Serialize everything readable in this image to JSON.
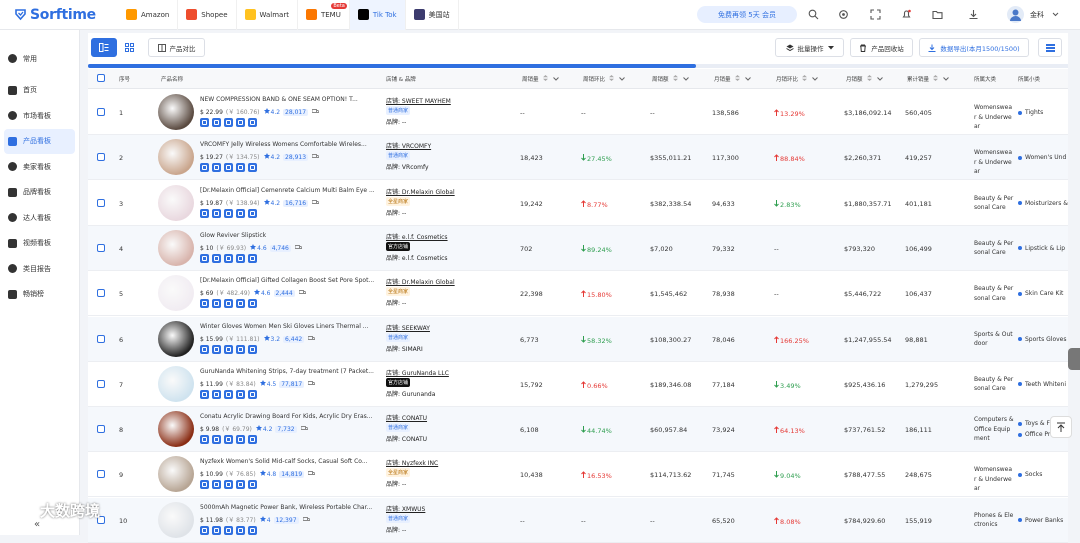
{
  "brand": {
    "name": "Sorftime"
  },
  "platforms": [
    {
      "label": "Amazon",
      "color": "#ff9900"
    },
    {
      "label": "Shopee",
      "color": "#ee4d2d"
    },
    {
      "label": "Walmart",
      "color": "#ffc220"
    },
    {
      "label": "TEMU",
      "color": "#fb7701",
      "badge": "Beta"
    },
    {
      "label": "Tik Tok",
      "color": "#000000"
    },
    {
      "label": "美国站",
      "color": "#3c3b6e"
    }
  ],
  "trial": "免费再领 5天 会员",
  "user": {
    "name": "金科"
  },
  "sidebar": [
    {
      "label": "常用"
    },
    {
      "label": "首页"
    },
    {
      "label": "市场看板"
    },
    {
      "label": "产品看板"
    },
    {
      "label": "卖家看板"
    },
    {
      "label": "品牌看板"
    },
    {
      "label": "达人看板"
    },
    {
      "label": "视频看板"
    },
    {
      "label": "类目报告"
    },
    {
      "label": "畅销榜"
    }
  ],
  "toolbar": {
    "compare": "产品对比",
    "batch": "批量操作",
    "recycle": "产品回收站",
    "export": "数据导出(本月1500/1500)"
  },
  "progress": 0.62,
  "columns": [
    "序号",
    "产品名称",
    "店铺 & 品牌",
    "周销量",
    "周销环比",
    "周销额",
    "月销量",
    "月销环比",
    "月销额",
    "累计销量",
    "所属大类",
    "所属小类"
  ],
  "rows": [
    {
      "idx": "1",
      "name": "NEW COMPRESSION BAND & ONE SEAM OPTION! T...",
      "price": "$ 22.99",
      "old": "(￥ 160.76)",
      "rating": "4.2",
      "reviews": "28,017",
      "shop": "店铺: SWEET MAYHEM",
      "tag": "普通商家",
      "tagc": "blue",
      "brand": "品牌: --",
      "wk": "--",
      "wkc": "--",
      "wkdir": "",
      "wkamt": "--",
      "mo": "138,586",
      "moc": "13.29%",
      "modir": "up",
      "moamt": "$3,186,092.14",
      "total": "560,405",
      "cat": "Womenswear & Underwear",
      "sub": [
        "Tights"
      ],
      "thumb": "#5a4a40"
    },
    {
      "idx": "2",
      "name": "VRCOMFY Jelly Wireless Womens Comfortable Wireles...",
      "price": "$ 19.27",
      "old": "(￥ 134.75)",
      "rating": "4.2",
      "reviews": "28,913",
      "shop": "店铺: VRCOMFY",
      "tag": "普通商家",
      "tagc": "blue",
      "brand": "品牌: VRcomfy",
      "wk": "18,423",
      "wkc": "27.45%",
      "wkdir": "down",
      "wkamt": "$355,011.21",
      "mo": "117,300",
      "moc": "88.84%",
      "modir": "up",
      "moamt": "$2,260,371",
      "total": "419,257",
      "cat": "Womenswear & Underwear",
      "sub": [
        "Women's Und"
      ],
      "thumb": "#c9a58c"
    },
    {
      "idx": "3",
      "name": "[Dr.Melaxin Official] Cemenrete Calcium Multi Balm Eye ...",
      "price": "$ 19.87",
      "old": "(￥ 138.94)",
      "rating": "4.2",
      "reviews": "16,716",
      "shop": "店铺: Dr.Melaxin Global",
      "tag": "全星商家",
      "tagc": "gold",
      "brand": "品牌: --",
      "wk": "19,242",
      "wkc": "8.77%",
      "wkdir": "up",
      "wkamt": "$382,338.54",
      "mo": "94,633",
      "moc": "2.83%",
      "modir": "down",
      "moamt": "$1,880,357.71",
      "total": "401,181",
      "cat": "Beauty & Personal Care",
      "sub": [
        "Moisturizers &"
      ],
      "thumb": "#e9d8df"
    },
    {
      "idx": "4",
      "name": "Glow Reviver Slipstick",
      "price": "$ 10",
      "old": "(￥ 69.93)",
      "rating": "4.6",
      "reviews": "4,746",
      "shop": "店铺: e.l.f. Cosmetics",
      "tag": "官方店铺",
      "tagc": "black",
      "brand": "品牌: e.l.f. Cosmetics",
      "wk": "702",
      "wkc": "89.24%",
      "wkdir": "down",
      "wkamt": "$7,020",
      "mo": "79,332",
      "moc": "--",
      "modir": "",
      "moamt": "$793,320",
      "total": "106,499",
      "cat": "Beauty & Personal Care",
      "sub": [
        "Lipstick & Lip"
      ],
      "thumb": "#d8b4ac"
    },
    {
      "idx": "5",
      "name": "[Dr.Melaxin Official] Gifted Collagen Boost Set Pore Spot...",
      "price": "$ 69",
      "old": "(￥ 482.49)",
      "rating": "4.6",
      "reviews": "2,444",
      "shop": "店铺: Dr.Melaxin Global",
      "tag": "全星商家",
      "tagc": "gold",
      "brand": "品牌: --",
      "wk": "22,398",
      "wkc": "15.80%",
      "wkdir": "up",
      "wkamt": "$1,545,462",
      "mo": "78,938",
      "moc": "--",
      "modir": "",
      "moamt": "$5,446,722",
      "total": "106,437",
      "cat": "Beauty & Personal Care",
      "sub": [
        "Skin Care Kit"
      ],
      "thumb": "#f1ecf2"
    },
    {
      "idx": "6",
      "name": "Winter Gloves Women Men Ski Gloves Liners Thermal ...",
      "price": "$ 15.99",
      "old": "(￥ 111.81)",
      "rating": "3.2",
      "reviews": "6,442",
      "shop": "店铺: SEEKWAY",
      "tag": "普通商家",
      "tagc": "blue",
      "brand": "品牌: SIMARI",
      "wk": "6,773",
      "wkc": "58.32%",
      "wkdir": "down",
      "wkamt": "$108,300.27",
      "mo": "78,046",
      "moc": "166.25%",
      "modir": "up",
      "moamt": "$1,247,955.54",
      "total": "98,881",
      "cat": "Sports & Outdoor",
      "sub": [
        "Sports Gloves"
      ],
      "thumb": "#222222"
    },
    {
      "idx": "7",
      "name": "GuruNanda Whitening Strips, 7-day treatment (7 Packet...",
      "price": "$ 11.99",
      "old": "(￥ 83.84)",
      "rating": "4.5",
      "reviews": "77,817",
      "shop": "店铺: GuruNanda LLC",
      "tag": "官方店铺",
      "tagc": "black",
      "brand": "品牌: Gurunanda",
      "wk": "15,792",
      "wkc": "0.66%",
      "wkdir": "up",
      "wkamt": "$189,346.08",
      "mo": "77,184",
      "moc": "3.49%",
      "modir": "down",
      "moamt": "$925,436.16",
      "total": "1,279,295",
      "cat": "Beauty & Personal Care",
      "sub": [
        "Teeth Whiteni"
      ],
      "thumb": "#cfe3ef"
    },
    {
      "idx": "8",
      "name": "Conatu Acrylic Drawing Board For Kids, Acrylic Dry Eras...",
      "price": "$ 9.98",
      "old": "(￥ 69.79)",
      "rating": "4.2",
      "reviews": "7,732",
      "shop": "店铺: CONATU",
      "tag": "普通商家",
      "tagc": "blue",
      "brand": "品牌: CONATU",
      "wk": "6,108",
      "wkc": "44.74%",
      "wkdir": "down",
      "wkamt": "$60,957.84",
      "mo": "73,924",
      "moc": "64.13%",
      "modir": "up",
      "moamt": "$737,761.52",
      "total": "186,111",
      "cat": "Computers & Office Equipment",
      "sub": [
        "Toys & F",
        "Office Pr"
      ],
      "thumb": "#8a2d14"
    },
    {
      "idx": "9",
      "name": "Nyzfexk Women's Solid Mid-calf Socks, Casual Soft Co...",
      "price": "$ 10.99",
      "old": "(￥ 76.85)",
      "rating": "4.8",
      "reviews": "14,819",
      "shop": "店铺: Nyzfexk INC",
      "tag": "全星商家",
      "tagc": "gold",
      "brand": "品牌: --",
      "wk": "10,438",
      "wkc": "16.53%",
      "wkdir": "up",
      "wkamt": "$114,713.62",
      "mo": "71,745",
      "moc": "9.04%",
      "modir": "down",
      "moamt": "$788,477.55",
      "total": "248,675",
      "cat": "Womenswear & Underwear",
      "sub": [
        "Socks"
      ],
      "thumb": "#b7a594"
    },
    {
      "idx": "10",
      "name": "5000mAh Magnetic Power Bank, Wireless Portable Char...",
      "price": "$ 11.98",
      "old": "(￥ 83.77)",
      "rating": "4",
      "reviews": "12,397",
      "shop": "店铺: XMWUS",
      "tag": "普通商家",
      "tagc": "blue",
      "brand": "品牌: --",
      "wk": "--",
      "wkc": "--",
      "wkdir": "",
      "wkamt": "--",
      "mo": "65,520",
      "moc": "8.08%",
      "modir": "up",
      "moamt": "$784,929.60",
      "total": "155,919",
      "cat": "Phones & Electronics",
      "sub": [
        "Power Banks"
      ],
      "thumb": "#dfe3e8"
    }
  ],
  "watermark": "大数跨境",
  "collapse": "«"
}
